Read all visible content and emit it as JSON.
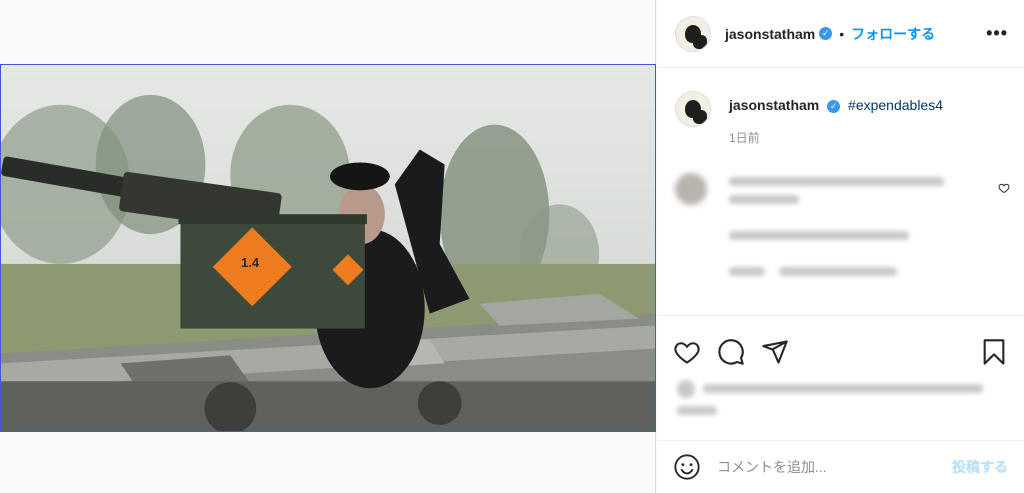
{
  "post": {
    "username": "jasonstatham",
    "verified_mark": "✓",
    "separator": "•",
    "follow_label": "フォローする",
    "more_label": "•••",
    "caption_hashtag": "#expendables4",
    "timestamp": "1日前"
  },
  "media": {
    "crate_label": "1.4"
  },
  "actions": {
    "like_icon": "heart-icon",
    "comment_icon": "comment-bubble-icon",
    "share_icon": "paper-plane-icon",
    "save_icon": "bookmark-icon"
  },
  "comment_box": {
    "placeholder": "コメントを追加...",
    "post_label": "投稿する"
  },
  "colors": {
    "accent": "#0095f6",
    "post_disabled": "#b2dffc",
    "hashtag": "#00376b",
    "verified": "#3897f0"
  }
}
